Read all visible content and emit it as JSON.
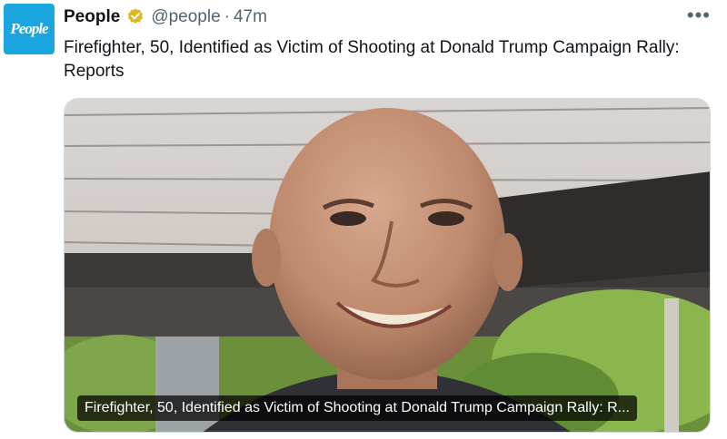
{
  "account": {
    "avatar_text": "People",
    "name": "People",
    "verified": true,
    "handle": "@people",
    "separator": "·",
    "time": "47m",
    "more_icon": "more-horizontal-icon"
  },
  "tweet": {
    "text": "Firefighter, 50, Identified as Victim of Shooting at Donald Trump Campaign Rally: Reports"
  },
  "card": {
    "title": "Firefighter, 50, Identified as Victim of Shooting at Donald Trump Campaign Rally: R..."
  },
  "colors": {
    "brand": "#1aa4e0",
    "verified_badge": "#e2b719",
    "secondary_text": "#536471"
  }
}
